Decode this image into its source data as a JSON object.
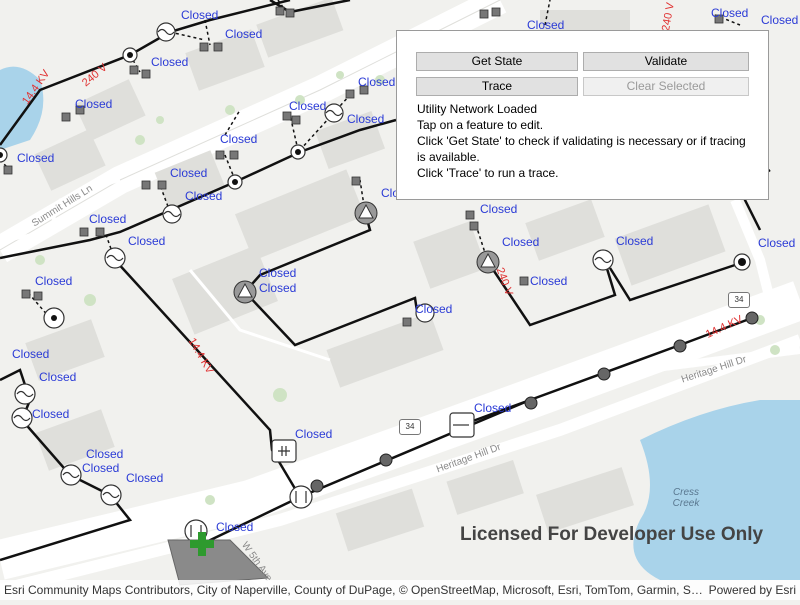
{
  "panel": {
    "buttons": {
      "get_state": "Get State",
      "validate": "Validate",
      "trace": "Trace",
      "clear_selected": "Clear Selected"
    },
    "status_lines": [
      "Utility Network Loaded",
      "Tap on a feature to edit.",
      "Click 'Get State' to check if validating is necessary or if tracing is available.",
      "Click 'Trace' to run a trace."
    ]
  },
  "map": {
    "feature_labels": {
      "closed": "Closed",
      "clo_partial": "Clo",
      "sed_partial": "sed",
      "osed_partial": "osed",
      "osed_partial2": "osed"
    },
    "line_labels": {
      "kv_14_4": "14.4 KV",
      "v_240": "240 V",
      "v_240_b": "240 V",
      "v_240_c": "240 V",
      "kv_14_4_b": "14.4 KV",
      "kv_14_4_c": "14.4 KV"
    },
    "road_labels": {
      "summit_hills": "Summit Hills Ln",
      "heritage_hill_dr_1": "Heritage Hill Dr",
      "heritage_hill_dr_2": "Heritage Hill Dr",
      "w_5th_ave": "W 5th Ave"
    },
    "water_label": "Cress\nCreek",
    "route_shields": [
      "34",
      "34"
    ],
    "watermark": "Licensed For Developer Use Only",
    "attribution": "Esri Community Maps Contributors, City of Naperville, County of DuPage, © OpenStreetMap, Microsoft, Esri, TomTom, Garmin, Saf...",
    "powered_by": "Powered by Esri"
  },
  "colors": {
    "map_background": "#f1f1ee",
    "label_blue": "#2b3bd6",
    "kv_red": "#e03030",
    "line_black": "#111111",
    "water": "#a9d3ea",
    "selection_green": "#2e9a2e"
  }
}
